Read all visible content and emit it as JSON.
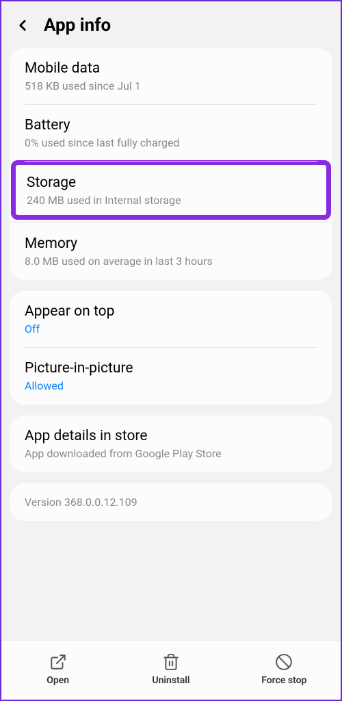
{
  "header": {
    "title": "App info"
  },
  "group1": {
    "mobile_data": {
      "title": "Mobile data",
      "subtitle": "518 KB used since Jul 1"
    },
    "battery": {
      "title": "Battery",
      "subtitle": "0% used since last fully charged"
    },
    "storage": {
      "title": "Storage",
      "subtitle": "240 MB used in Internal storage"
    },
    "memory": {
      "title": "Memory",
      "subtitle": "8.0 MB used on average in last 3 hours"
    }
  },
  "group2": {
    "appear_on_top": {
      "title": "Appear on top",
      "value": "Off"
    },
    "pip": {
      "title": "Picture-in-picture",
      "value": "Allowed"
    }
  },
  "group3": {
    "app_details": {
      "title": "App details in store",
      "subtitle": "App downloaded from Google Play Store"
    }
  },
  "version": "Version 368.0.0.12.109",
  "bottom": {
    "open": "Open",
    "uninstall": "Uninstall",
    "force_stop": "Force stop"
  }
}
